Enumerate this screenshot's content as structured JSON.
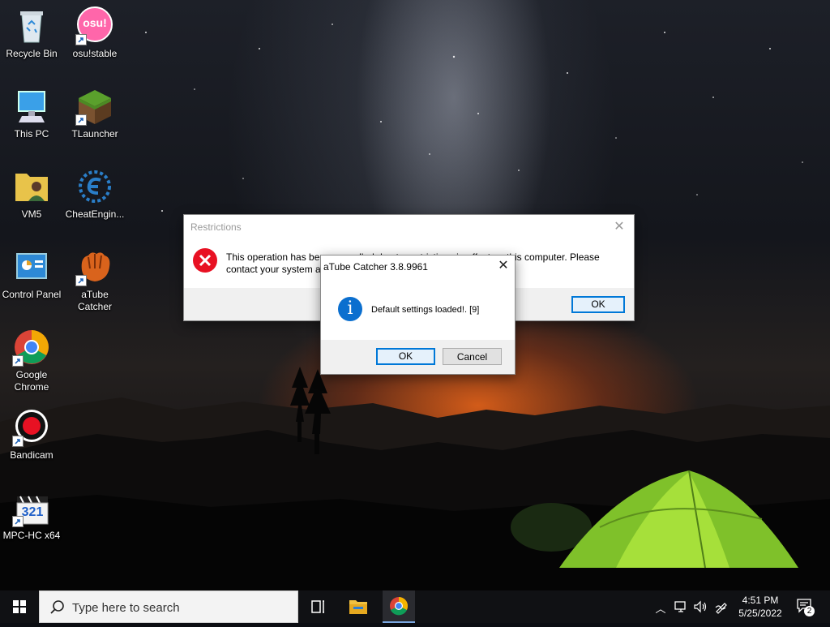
{
  "desktop": {
    "icons": [
      {
        "label": "Recycle Bin"
      },
      {
        "label": "osu!stable",
        "badge": "osu!"
      },
      {
        "label": "This PC"
      },
      {
        "label": "TLauncher"
      },
      {
        "label": "VM5"
      },
      {
        "label": "CheatEngin..."
      },
      {
        "label": "Control Panel"
      },
      {
        "label": "aTube Catcher"
      },
      {
        "label": "Google Chrome"
      },
      {
        "label": "Bandicam"
      },
      {
        "label": "MPC-HC x64",
        "badge": "321"
      }
    ]
  },
  "restrictions_dialog": {
    "title": "Restrictions",
    "message": "This operation has been cancelled due to restrictions in effect on this computer. Please contact your system administrator.",
    "ok_label": "OK",
    "icon": "error-icon",
    "close_glyph": "✕"
  },
  "atube_dialog": {
    "title": "aTube Catcher 3.8.9961",
    "message": "Default settings loaded!. [9]",
    "ok_label": "OK",
    "cancel_label": "Cancel",
    "icon": "info-icon",
    "info_glyph": "i",
    "close_glyph": "✕"
  },
  "taskbar": {
    "search_placeholder": "Type here to search",
    "pinned": [
      "task-view-icon",
      "file-explorer-icon",
      "chrome-icon"
    ],
    "clock_time": "4:51 PM",
    "clock_date": "5/25/2022",
    "notification_count": "2",
    "tray_chevron": "︿"
  },
  "colors": {
    "accent": "#0078d7",
    "error_red": "#e81123",
    "info_blue": "#0b6fcf",
    "taskbar_bg": "#101114"
  }
}
